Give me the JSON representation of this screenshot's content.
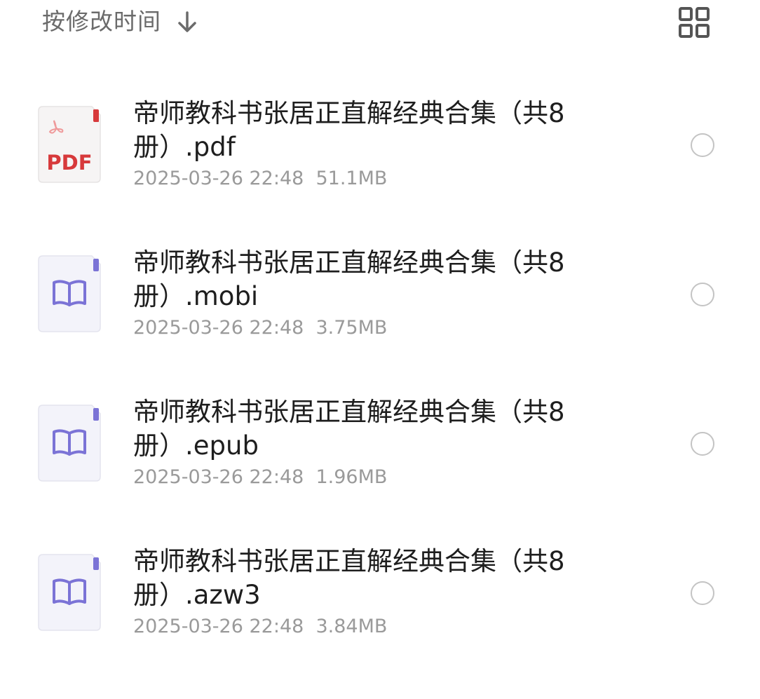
{
  "toolbar": {
    "sort_label": "按修改时间",
    "sort_icon": "arrow-down-icon",
    "view_toggle_icon": "grid-view-icon"
  },
  "colors": {
    "text_primary": "#1e1e1e",
    "text_secondary": "#9a9a9a",
    "pdf_red": "#d7393b",
    "ebook_purple": "#7b73d6",
    "radio_border": "#c4c4c4"
  },
  "files": [
    {
      "name": "帝师教科书张居正直解经典合集（共8册）.pdf",
      "date": "2025-03-26 22:48",
      "size": "51.1MB",
      "icon": "pdf-file-icon",
      "icon_label": "PDF"
    },
    {
      "name": "帝师教科书张居正直解经典合集（共8册）.mobi",
      "date": "2025-03-26 22:48",
      "size": "3.75MB",
      "icon": "ebook-file-icon"
    },
    {
      "name": "帝师教科书张居正直解经典合集（共8册）.epub",
      "date": "2025-03-26 22:48",
      "size": "1.96MB",
      "icon": "ebook-file-icon"
    },
    {
      "name": "帝师教科书张居正直解经典合集（共8册）.azw3",
      "date": "2025-03-26 22:48",
      "size": "3.84MB",
      "icon": "ebook-file-icon"
    }
  ]
}
